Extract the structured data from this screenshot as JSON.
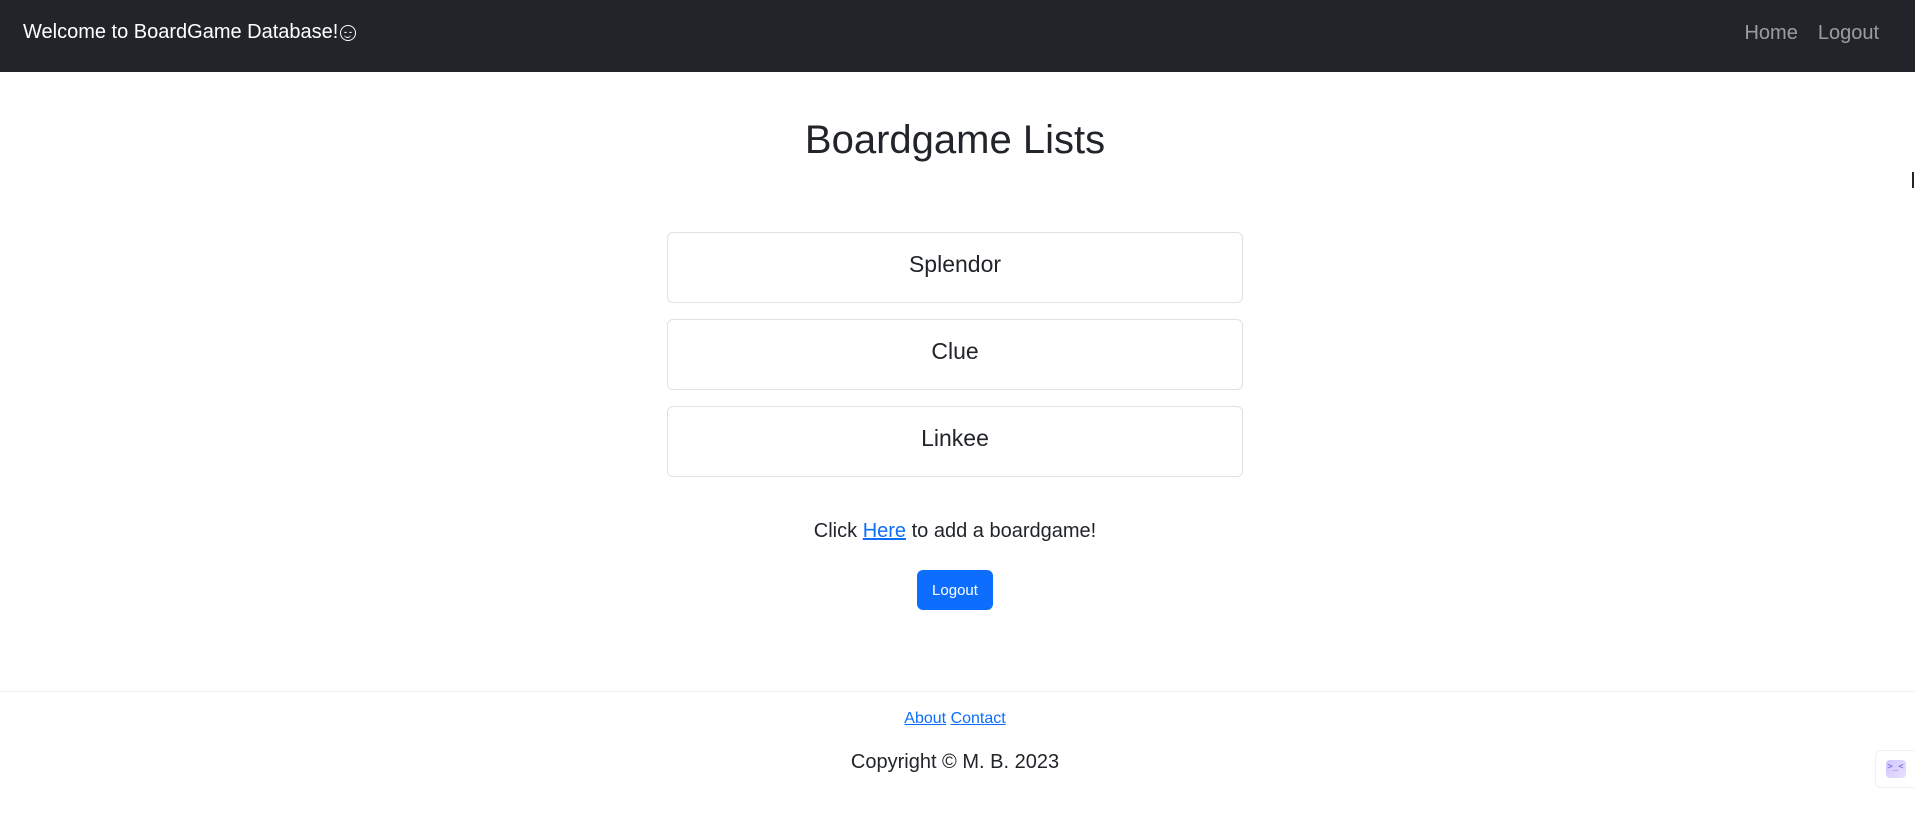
{
  "navbar": {
    "brand": "Welcome to BoardGame Database!",
    "brand_icon": "smiling-face-icon",
    "links": [
      {
        "label": "Home"
      },
      {
        "label": "Logout"
      }
    ]
  },
  "main": {
    "title": "Boardgame Lists",
    "games": [
      {
        "name": "Splendor"
      },
      {
        "name": "Clue"
      },
      {
        "name": "Linkee"
      }
    ],
    "add_prefix": "Click ",
    "add_link": "Here",
    "add_suffix": " to add a boardgame!",
    "logout_button": "Logout"
  },
  "footer": {
    "links": [
      {
        "label": "About"
      },
      {
        "label": "Contact"
      }
    ],
    "copyright": "Copyright © M. B. 2023"
  },
  "colors": {
    "navbar_bg": "#212529",
    "primary": "#0d6efd"
  },
  "widget": {
    "icon": "devtools-widget-icon",
    "glyph": ">_<"
  }
}
